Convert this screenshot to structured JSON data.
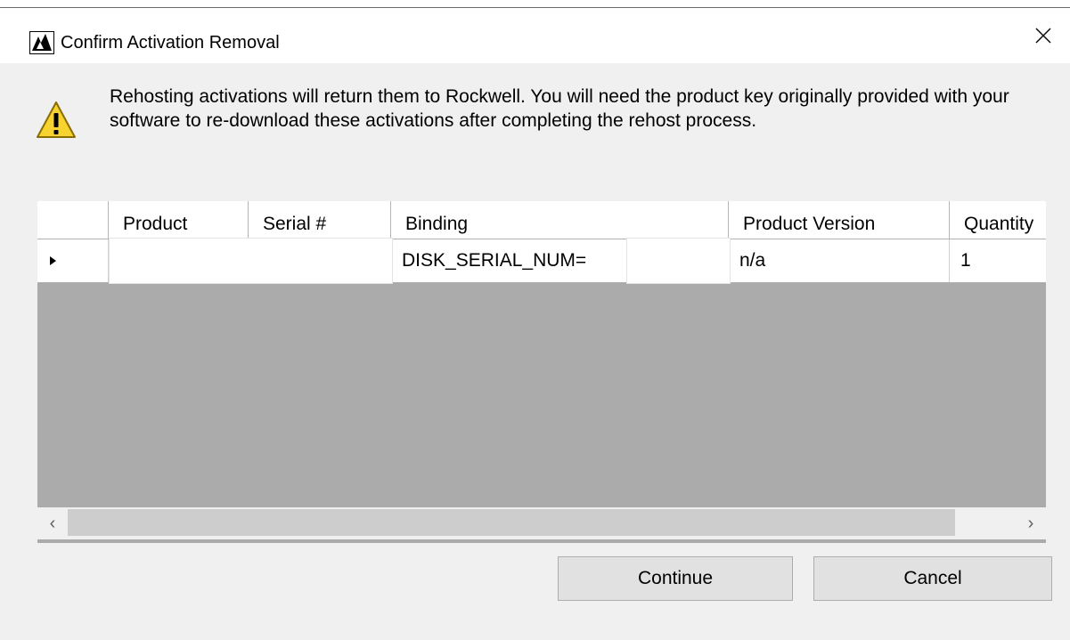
{
  "window": {
    "title": "Confirm Activation Removal",
    "app_icon": "app-logo-icon",
    "close_icon": "close-icon"
  },
  "message": {
    "icon": "warning-icon",
    "text": "Rehosting activations will return them to Rockwell. You will need the product key originally provided with your software to re-download these activations after completing the rehost process."
  },
  "grid": {
    "columns": [
      "Product",
      "Serial #",
      "Binding",
      "Product Version",
      "Quantity"
    ],
    "rows": [
      {
        "product": "",
        "serial": "",
        "binding": "DISK_SERIAL_NUM=",
        "product_version": "n/a",
        "quantity": "1"
      }
    ]
  },
  "scrollbar": {
    "left_arrow": "‹",
    "right_arrow": "›"
  },
  "buttons": {
    "continue": "Continue",
    "cancel": "Cancel"
  }
}
